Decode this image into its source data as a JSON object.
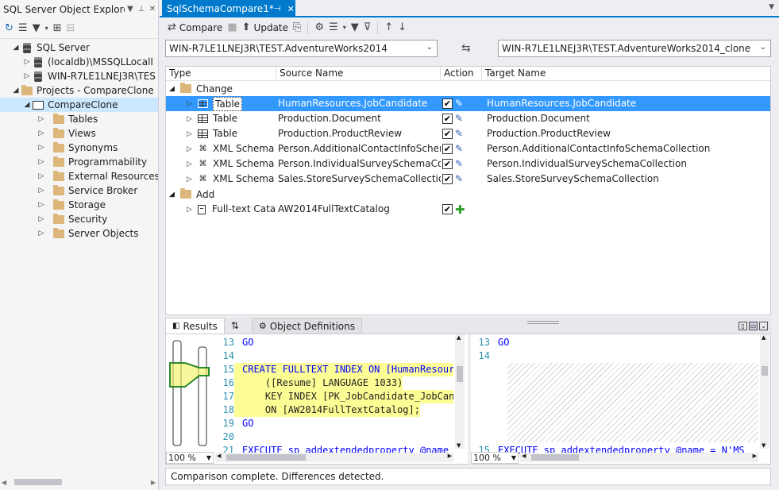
{
  "explorer": {
    "title": "SQL Server Object Explorer",
    "tree": [
      {
        "label": "SQL Server",
        "level": 1,
        "expanded": true,
        "icon": "server-icon"
      },
      {
        "label": "(localdb)\\MSSQLLocalI",
        "level": 2,
        "expanded": false,
        "icon": "server-instance-icon"
      },
      {
        "label": "WIN-R7LE1LNEJ3R\\TES",
        "level": 2,
        "expanded": false,
        "icon": "server-instance-icon"
      },
      {
        "label": "Projects - CompareClone",
        "level": 1,
        "expanded": true,
        "icon": "folder-icon"
      },
      {
        "label": "CompareClone",
        "level": 2,
        "expanded": true,
        "icon": "project-icon",
        "selected": true
      },
      {
        "label": "Tables",
        "level": 3,
        "icon": "folder-icon"
      },
      {
        "label": "Views",
        "level": 3,
        "icon": "folder-icon"
      },
      {
        "label": "Synonyms",
        "level": 3,
        "icon": "folder-icon"
      },
      {
        "label": "Programmability",
        "level": 3,
        "icon": "folder-icon"
      },
      {
        "label": "External Resources",
        "level": 3,
        "icon": "folder-icon"
      },
      {
        "label": "Service Broker",
        "level": 3,
        "icon": "folder-icon"
      },
      {
        "label": "Storage",
        "level": 3,
        "icon": "folder-icon"
      },
      {
        "label": "Security",
        "level": 3,
        "icon": "folder-icon"
      },
      {
        "label": "Server Objects",
        "level": 3,
        "icon": "folder-icon"
      }
    ]
  },
  "document": {
    "tab_title": "SqlSchemaCompare1*",
    "toolbar": {
      "compare_label": "Compare",
      "update_label": "Update"
    },
    "source_db": "WIN-R7LE1LNEJ3R\\TEST.AdventureWorks2014",
    "target_db": "WIN-R7LE1LNEJ3R\\TEST.AdventureWorks2014_clone",
    "grid": {
      "columns": [
        "Type",
        "Source Name",
        "Action",
        "Target Name"
      ],
      "groups": [
        {
          "name": "Change",
          "rows": [
            {
              "type": "Table",
              "source": "HumanResources.JobCandidate",
              "action": "edit",
              "target": "HumanResources.JobCandidate",
              "selected": true,
              "icon": "table-icon"
            },
            {
              "type": "Table",
              "source": "Production.Document",
              "action": "edit",
              "target": "Production.Document",
              "icon": "table-icon"
            },
            {
              "type": "Table",
              "source": "Production.ProductReview",
              "action": "edit",
              "target": "Production.ProductReview",
              "icon": "table-icon"
            },
            {
              "type": "XML Schema C",
              "source": "Person.AdditionalContactInfoSchemaC",
              "action": "edit",
              "target": "Person.AdditionalContactInfoSchemaCollection",
              "icon": "xml-schema-icon"
            },
            {
              "type": "XML Schema C",
              "source": "Person.IndividualSurveySchemaCollect",
              "action": "edit",
              "target": "Person.IndividualSurveySchemaCollection",
              "icon": "xml-schema-icon"
            },
            {
              "type": "XML Schema C",
              "source": "Sales.StoreSurveySchemaCollection",
              "action": "edit",
              "target": "Sales.StoreSurveySchemaCollection",
              "icon": "xml-schema-icon"
            }
          ]
        },
        {
          "name": "Add",
          "rows": [
            {
              "type": "Full-text Catalc",
              "source": "AW2014FullTextCatalog",
              "action": "add",
              "target": "",
              "icon": "fulltext-catalog-icon"
            }
          ]
        }
      ]
    },
    "bottom_tabs": {
      "results": "Results",
      "object_definitions": "Object Definitions"
    },
    "left_code": [
      {
        "n": "13",
        "text": "GO"
      },
      {
        "n": "14",
        "text": ""
      },
      {
        "n": "15",
        "text": "CREATE FULLTEXT INDEX ON [HumanResour"
      },
      {
        "n": "16",
        "text": "    ([Resume] LANGUAGE 1033)"
      },
      {
        "n": "17",
        "text": "    KEY INDEX [PK_JobCandidate_JobCan"
      },
      {
        "n": "18",
        "text": "    ON [AW2014FullTextCatalog];"
      },
      {
        "n": "19",
        "text": "GO"
      },
      {
        "n": "20",
        "text": ""
      },
      {
        "n": "21",
        "text": "EXECUTE sp_addextendedproperty @name"
      }
    ],
    "right_code": [
      {
        "n": "13",
        "text": "GO"
      },
      {
        "n": "14",
        "text": ""
      },
      {
        "n": "15",
        "text": "EXECUTE sp_addextendedproperty @name = N'MS"
      }
    ],
    "zoom_left": "100 %",
    "zoom_right": "100 %",
    "status": "Comparison complete.  Differences detected."
  },
  "colors": {
    "accent": "#007acc",
    "selection": "#3399ff",
    "highlight": "#fdfd96",
    "keyword": "#0000ff",
    "line_number": "#2b91af"
  }
}
